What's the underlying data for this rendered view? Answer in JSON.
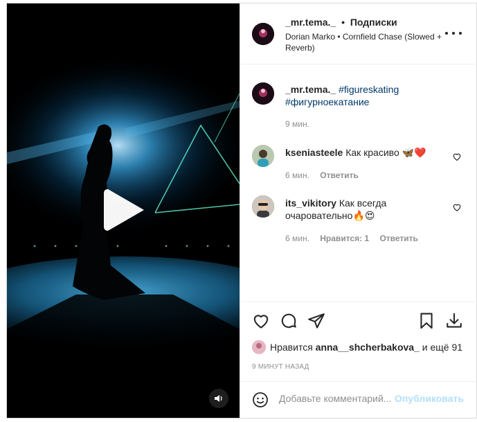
{
  "post": {
    "username": "_mr.tema._",
    "separator": "•",
    "follow_label": "Подписки",
    "audio": "Dorian Marko • Cornfield Chase (Slowed + Reverb)"
  },
  "caption": {
    "username": "_mr.tema._",
    "hashtag1": "#figureskating",
    "hashtag2": "#фигурноекатание",
    "time": "9 мин."
  },
  "comments": [
    {
      "username": "kseniasteele",
      "text": "Как красиво 🦋❤️",
      "time": "6 мин.",
      "reply_label": "Ответить"
    },
    {
      "username": "its_vikitory",
      "text": "Как всегда очаровательно🔥😍",
      "time": "6 мин.",
      "likes_label": "Нравится: 1",
      "reply_label": "Ответить"
    }
  ],
  "likes": {
    "prefix": "Нравится",
    "user": "anna__shcherbakova_",
    "suffix": "и ещё 91"
  },
  "timestamp": "9 МИНУТ НАЗАД",
  "add_comment": {
    "placeholder": "Добавьте комментарий...",
    "publish_label": "Опубликовать"
  },
  "colors": {
    "text": "#262626",
    "secondary": "#8e8e8e",
    "link": "#00376b",
    "publish_disabled": "#b2dffc",
    "video_glow": "#3aa8e6"
  }
}
